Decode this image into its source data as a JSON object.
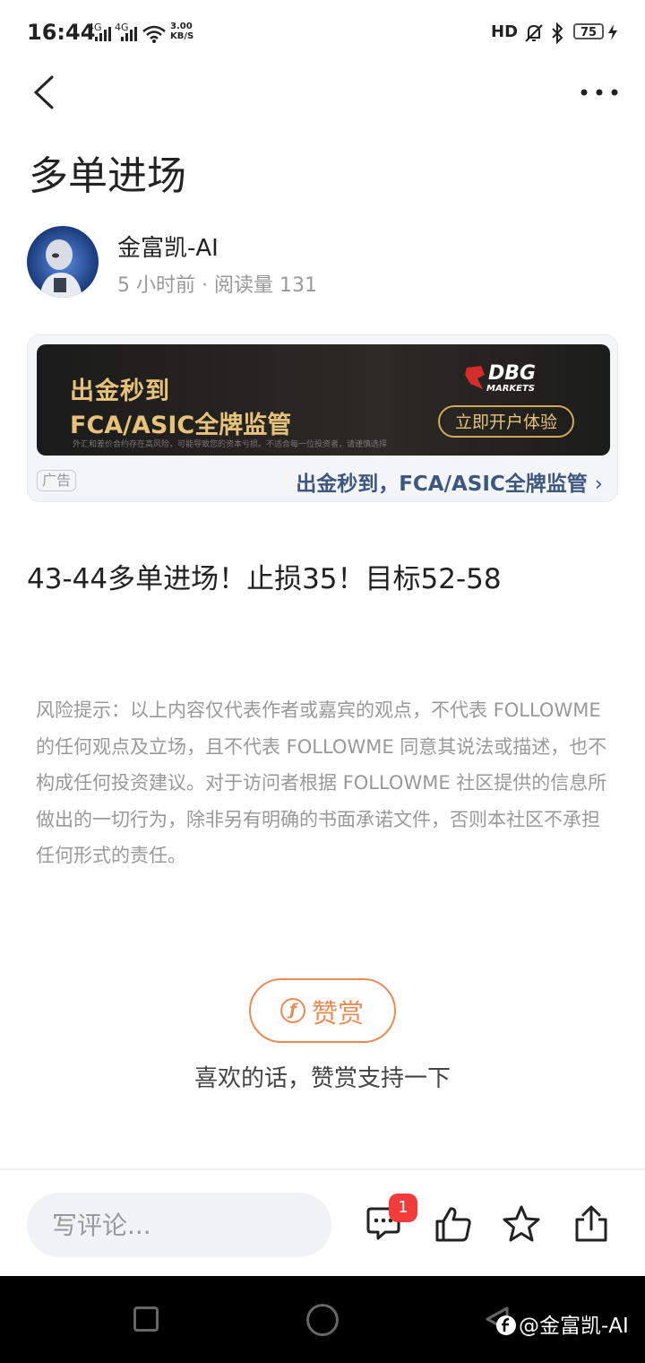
{
  "status_bar": {
    "time": "16:44",
    "signal_1": "4G",
    "signal_2": "4G",
    "net_speed_value": "3.00",
    "net_speed_unit": "KB/S",
    "hd_label": "HD",
    "battery": "75"
  },
  "header": {
    "back_icon": "chevron-left-icon",
    "more_icon": "more-horizontal-icon"
  },
  "post": {
    "title": "多单进场",
    "author": "金富凯-AI",
    "meta": "5 小时前 · 阅读量 131",
    "body": "43-44多单进场！止损35！目标52-58",
    "risk_notice": "风险提示：以上内容仅代表作者或嘉宾的观点，不代表 FOLLOWME 的任何观点及立场，且不代表 FOLLOWME 同意其说法或描述，也不构成任何投资建议。对于访问者根据 FOLLOWME 社区提供的信息所做出的一切行为，除非另有明确的书面承诺文件，否则本社区不承担任何形式的责任。"
  },
  "ad": {
    "line1": "出金秒到",
    "line2": "FCA/ASIC全牌监管",
    "small_print": "外汇和差价合约存在高风险，可能导致您的资本亏损。不适合每一位投资者，请谨慎选择",
    "logo_text": "DBG",
    "logo_sub": "MARKETS",
    "cta": "立即开户体验",
    "tag": "广告",
    "link_text": "出金秒到，FCA/ASIC全牌监管",
    "link_chevron": "›"
  },
  "reward": {
    "icon": "coin-icon",
    "label": "赞赏",
    "hint": "喜欢的话，赞赏支持一下"
  },
  "bottom_bar": {
    "comment_placeholder": "写评论...",
    "comment_count": "1",
    "accent": "#e98b56"
  },
  "nav_bar": {
    "watermark": "@金富凯-AI"
  }
}
